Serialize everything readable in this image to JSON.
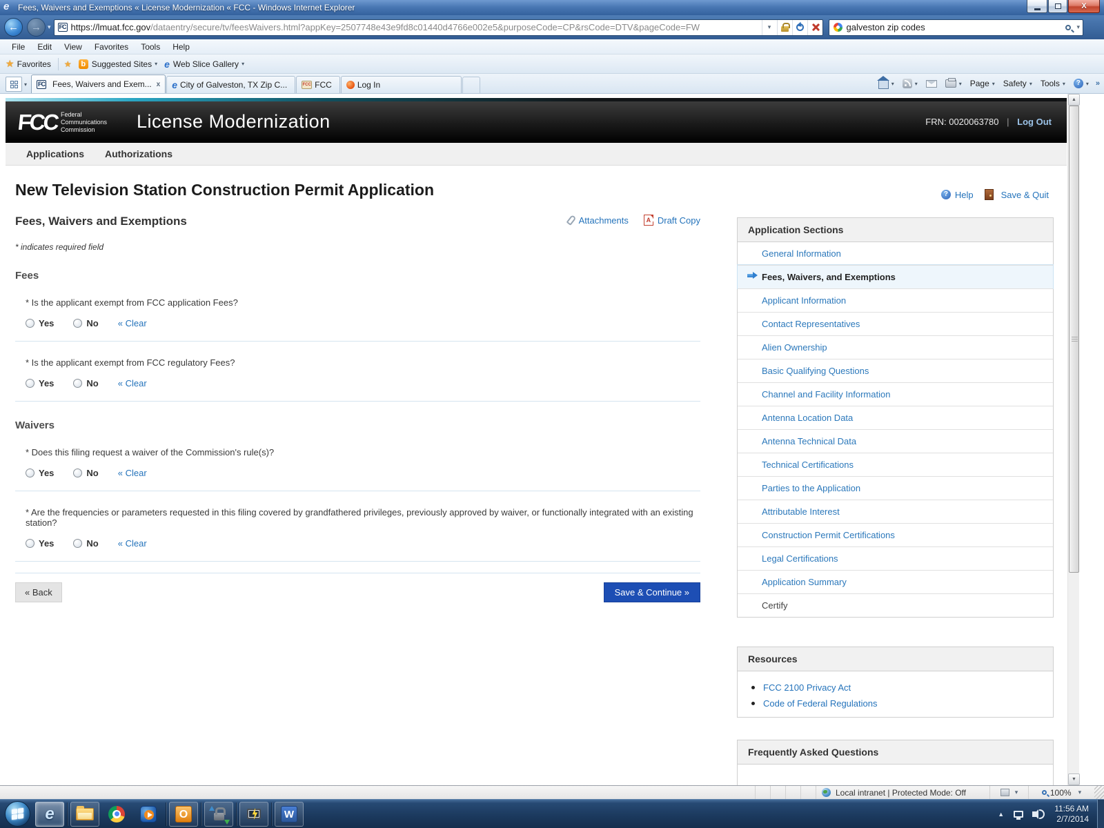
{
  "titlebar": {
    "title": "Fees, Waivers and Exemptions « License Modernization « FCC - Windows Internet Explorer"
  },
  "toolbar": {
    "url_host": "https://lmuat.fcc.gov",
    "url_path": "/dataentry/secure/tv/feesWaivers.html?appKey=2507748e43e9fd8c01440d4766e002e5&purposeCode=CP&rsCode=DTV&pageCode=FW",
    "search_value": "galveston zip codes"
  },
  "menubar": {
    "items": [
      "File",
      "Edit",
      "View",
      "Favorites",
      "Tools",
      "Help"
    ]
  },
  "favorites_bar": {
    "favorites_label": "Favorites",
    "suggested_sites_label": "Suggested Sites",
    "web_slice_label": "Web Slice Gallery"
  },
  "tab_row": {
    "tabs": [
      {
        "label": "Fees, Waivers and Exem...",
        "close": "x"
      },
      {
        "label": "City of Galveston, TX Zip C..."
      },
      {
        "label": "FCC"
      },
      {
        "label": "Log In"
      }
    ],
    "page_label": "Page",
    "safety_label": "Safety",
    "tools_label": "Tools",
    "more_chevron": "»"
  },
  "app_header": {
    "logo_text": "FCC",
    "caption_line1": "Federal",
    "caption_line2": "Communications",
    "caption_line3": "Commission",
    "app_title": "License Modernization",
    "frn_label": "FRN: 0020063780",
    "pipe": "|",
    "logout_label": "Log Out"
  },
  "app_nav": {
    "items": [
      "Applications",
      "Authorizations"
    ]
  },
  "content": {
    "page_title": "New Television Station Construction Permit Application",
    "help_label": "Help",
    "save_quit_label": "Save & Quit",
    "section_title": "Fees, Waivers and Exemptions",
    "attachments_label": "Attachments",
    "draft_copy_label": "Draft Copy",
    "required_note": "* indicates required field",
    "yes_label": "Yes",
    "no_label": "No",
    "clear_label": "« Clear",
    "groups": [
      {
        "heading": "Fees",
        "questions": [
          "* Is the applicant exempt from FCC application Fees?",
          "* Is the applicant exempt from FCC regulatory Fees?"
        ]
      },
      {
        "heading": "Waivers",
        "questions": [
          "* Does this filing request a waiver of the Commission's rule(s)?",
          "* Are the frequencies or parameters requested in this filing covered by grandfathered privileges, previously approved by waiver, or functionally integrated with an existing station?"
        ]
      }
    ],
    "back_label": "« Back",
    "save_continue_label": "Save & Continue »"
  },
  "sidebar": {
    "sections_title": "Application Sections",
    "items": [
      {
        "label": "General Information",
        "active": false,
        "link": true
      },
      {
        "label": "Fees, Waivers, and Exemptions",
        "active": true,
        "link": true
      },
      {
        "label": "Applicant Information",
        "active": false,
        "link": true
      },
      {
        "label": "Contact Representatives",
        "active": false,
        "link": true
      },
      {
        "label": "Alien Ownership",
        "active": false,
        "link": true
      },
      {
        "label": "Basic Qualifying Questions",
        "active": false,
        "link": true
      },
      {
        "label": "Channel and Facility Information",
        "active": false,
        "link": true
      },
      {
        "label": "Antenna Location Data",
        "active": false,
        "link": true
      },
      {
        "label": "Antenna Technical Data",
        "active": false,
        "link": true
      },
      {
        "label": "Technical Certifications",
        "active": false,
        "link": true
      },
      {
        "label": "Parties to the Application",
        "active": false,
        "link": true
      },
      {
        "label": "Attributable Interest",
        "active": false,
        "link": true
      },
      {
        "label": "Construction Permit Certifications",
        "active": false,
        "link": true
      },
      {
        "label": "Legal Certifications",
        "active": false,
        "link": true
      },
      {
        "label": "Application Summary",
        "active": false,
        "link": true
      },
      {
        "label": "Certify",
        "active": false,
        "link": false
      }
    ],
    "resources_title": "Resources",
    "resources_links": [
      "FCC 2100 Privacy Act",
      "Code of Federal Regulations"
    ],
    "faq_title": "Frequently Asked Questions"
  },
  "statusbar": {
    "zone_text": "Local intranet | Protected Mode: Off",
    "zoom_text": "100%"
  },
  "taskbar": {
    "clock_time": "11:56 AM",
    "clock_date": "2/7/2014"
  }
}
